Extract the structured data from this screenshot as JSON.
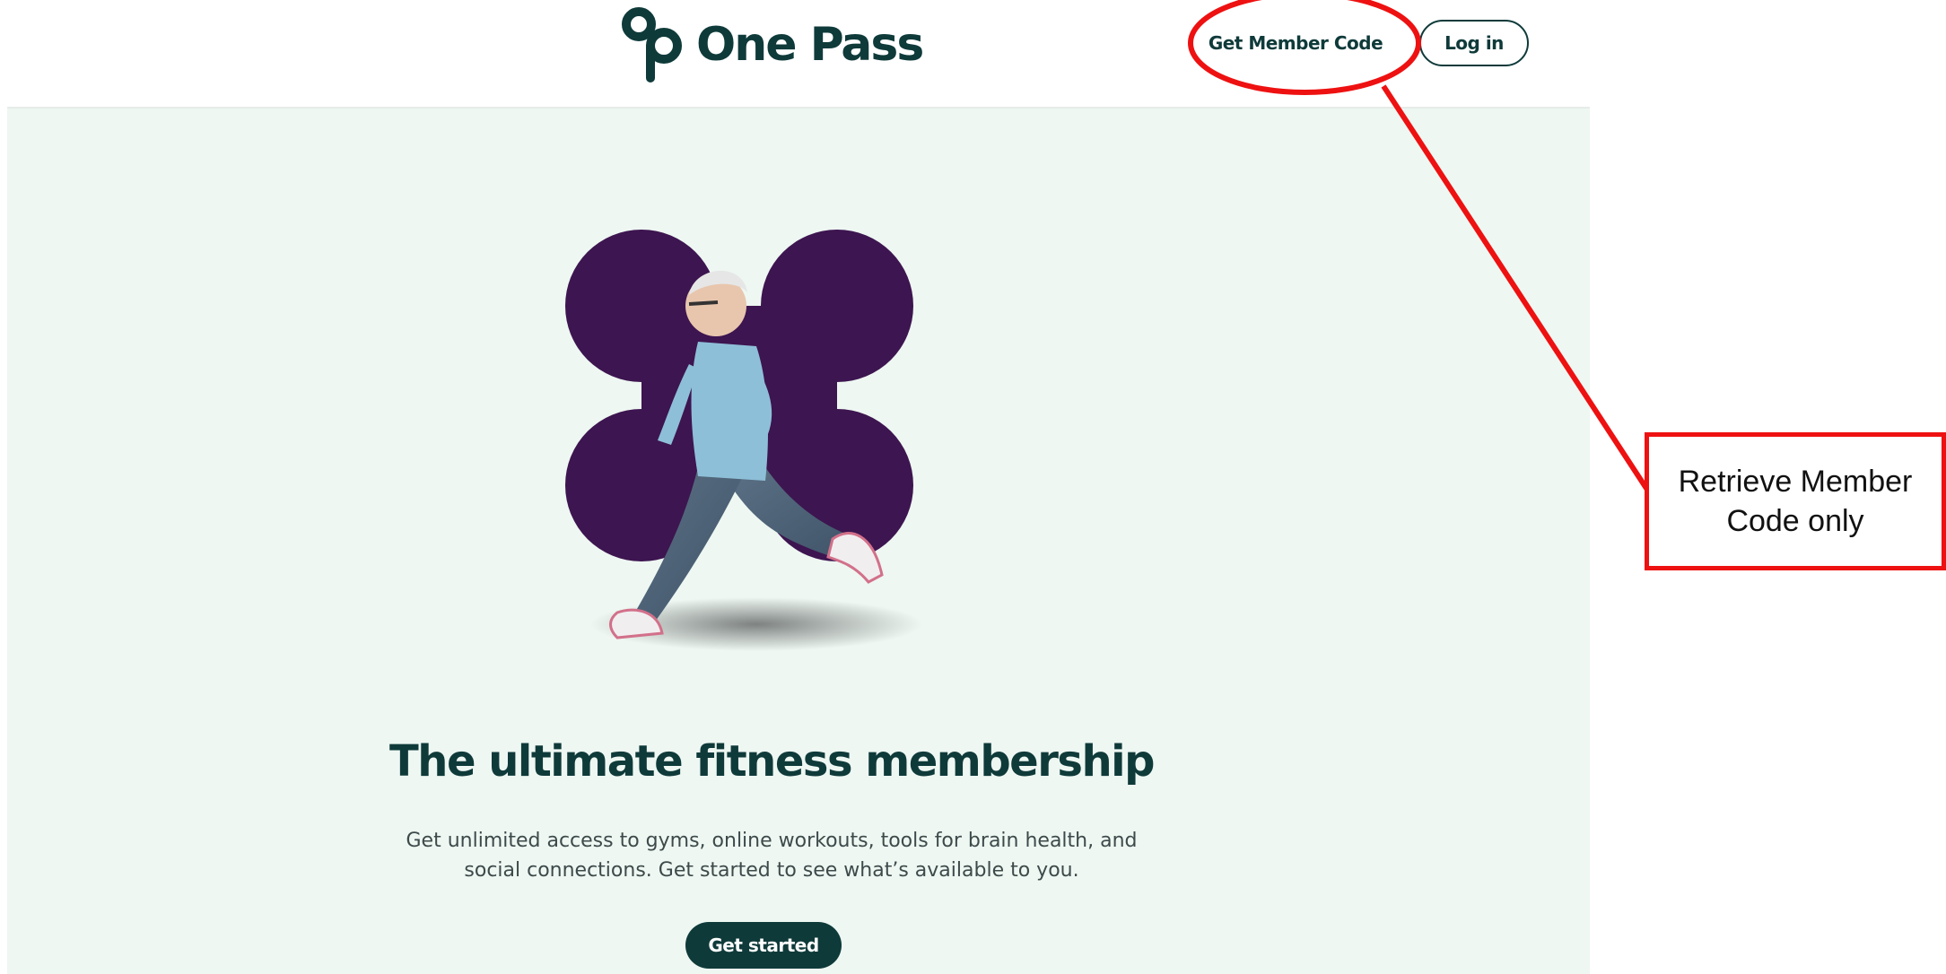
{
  "header": {
    "logo_text": "One Pass",
    "nav_link_label": "Get Member Code",
    "login_label": "Log in"
  },
  "hero": {
    "title": "The ultimate fitness membership",
    "description": "Get unlimited access to gyms, online workouts, tools for brain health, and social connections. Get started to see what’s available to you.",
    "cta_label": "Get started"
  },
  "annotation": {
    "callout_text": "Retrieve Member Code only",
    "color": "#ee1111"
  },
  "colors": {
    "brand_dark": "#0f3a3a",
    "hero_background": "#eef7f2",
    "shape_purple": "#3d1550"
  },
  "icons": {
    "logo": "onepass-logo-icon"
  }
}
